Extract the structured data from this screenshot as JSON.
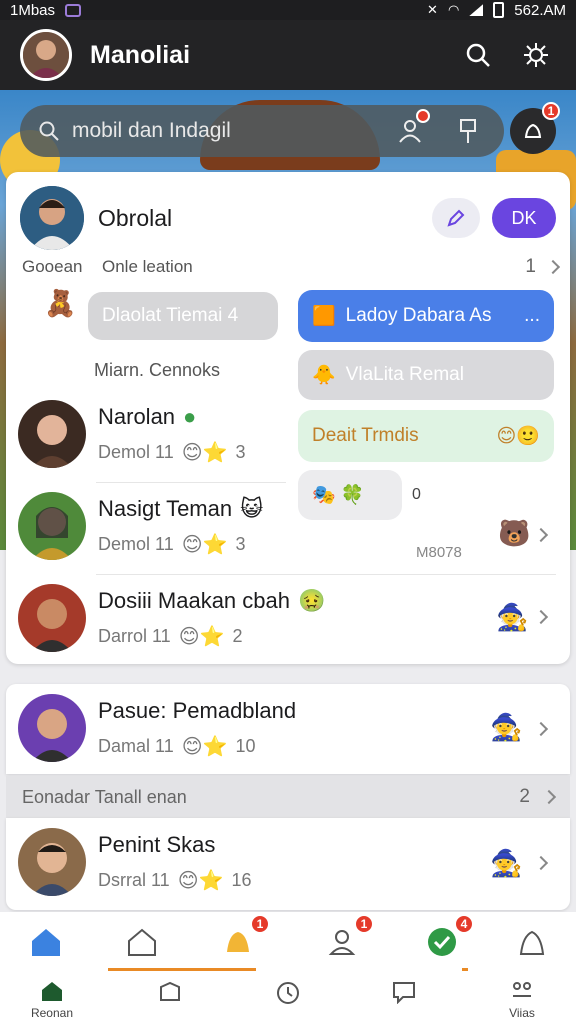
{
  "statusbar": {
    "left_text": "1Mbas",
    "right_text": "562.AM"
  },
  "appbar": {
    "title": "Manoliai"
  },
  "search": {
    "placeholder": "mobil dan Indagil",
    "action_badge": "",
    "notif_badge": "1"
  },
  "card": {
    "title": "Obrolal",
    "ok_label": "DK",
    "section": {
      "left": "Gooean",
      "label": "Onle leation",
      "count": "1"
    },
    "bubbles": {
      "left1": "Dlaolat Tiemai 4",
      "right1": "Ladoy Dabara As",
      "right1_more": "...",
      "left2": "Miarn. Cennoks",
      "right2": "VlaLita Remal",
      "right3": "Deait Trmdis",
      "reply_count": "0",
      "stamp": "M8078"
    },
    "chats": [
      {
        "name": "Narolan",
        "meta": "Demol 11",
        "score": "3"
      },
      {
        "name": "Nasigt Teman",
        "meta": "Demol 11",
        "score": "3"
      },
      {
        "name": "Dosiii Maakan cbah",
        "meta": "Darrol 11",
        "score": "2"
      }
    ]
  },
  "rows": [
    {
      "name": "Pasue: Pemadbland",
      "meta": "Damal 11",
      "score": "10"
    },
    {
      "name": "Penint Skas",
      "meta": "Dsrral 11",
      "score": "16"
    }
  ],
  "group_section": {
    "label": "Eonadar Tanall enan",
    "count": "2"
  },
  "tabs_top": [
    {
      "icon": "home-icon",
      "badge": ""
    },
    {
      "icon": "house-outline-icon",
      "badge": ""
    },
    {
      "icon": "bell-icon",
      "badge": "1"
    },
    {
      "icon": "contacts-icon",
      "badge": "1"
    },
    {
      "icon": "check-circle-icon",
      "badge": "4"
    },
    {
      "icon": "user-icon",
      "badge": ""
    }
  ],
  "tabs_bottom": [
    {
      "icon": "home-filled-icon",
      "label": "Reonan"
    },
    {
      "icon": "box-icon",
      "label": ""
    },
    {
      "icon": "clock-icon",
      "label": ""
    },
    {
      "icon": "chat-icon",
      "label": ""
    },
    {
      "icon": "more-icon",
      "label": "Viias"
    }
  ],
  "colors": {
    "accent": "#6a45e0",
    "badge": "#e53a2a",
    "bubble_blue": "#4a7fe8",
    "bubble_green": "#dff3e3",
    "tab_active": "#e98a25"
  }
}
